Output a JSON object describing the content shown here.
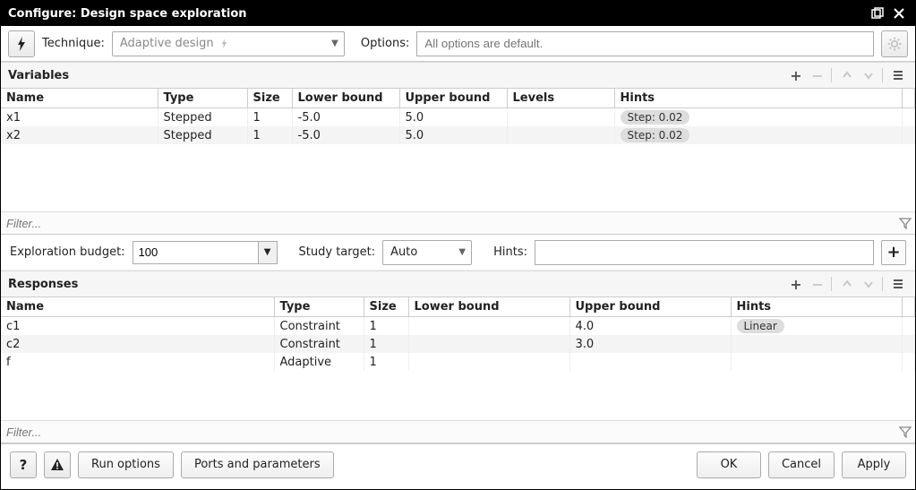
{
  "window": {
    "title": "Configure: Design space exploration"
  },
  "top": {
    "technique_label": "Technique:",
    "technique_value": "Adaptive design",
    "options_label": "Options:",
    "options_placeholder": "All options are default."
  },
  "variables": {
    "header": "Variables",
    "columns": [
      "Name",
      "Type",
      "Size",
      "Lower bound",
      "Upper bound",
      "Levels",
      "Hints"
    ],
    "rows": [
      {
        "name": "x1",
        "type": "Stepped",
        "size": "1",
        "lower": "-5.0",
        "upper": "5.0",
        "levels": "",
        "hints": "Step: 0.02"
      },
      {
        "name": "x2",
        "type": "Stepped",
        "size": "1",
        "lower": "-5.0",
        "upper": "5.0",
        "levels": "",
        "hints": "Step: 0.02"
      }
    ],
    "filter_placeholder": "Filter..."
  },
  "middle": {
    "budget_label": "Exploration budget:",
    "budget_value": "100",
    "study_label": "Study target:",
    "study_value": "Auto",
    "hints_label": "Hints:",
    "hints_value": ""
  },
  "responses": {
    "header": "Responses",
    "columns": [
      "Name",
      "Type",
      "Size",
      "Lower bound",
      "Upper bound",
      "Hints"
    ],
    "rows": [
      {
        "name": "c1",
        "type": "Constraint",
        "size": "1",
        "lower": "",
        "upper": "4.0",
        "hints": "Linear"
      },
      {
        "name": "c2",
        "type": "Constraint",
        "size": "1",
        "lower": "",
        "upper": "3.0",
        "hints": ""
      },
      {
        "name": "f",
        "type": "Adaptive",
        "size": "1",
        "lower": "",
        "upper": "",
        "hints": ""
      }
    ],
    "filter_placeholder": "Filter..."
  },
  "footer": {
    "run_options": "Run options",
    "ports_params": "Ports and parameters",
    "ok": "OK",
    "cancel": "Cancel",
    "apply": "Apply"
  }
}
